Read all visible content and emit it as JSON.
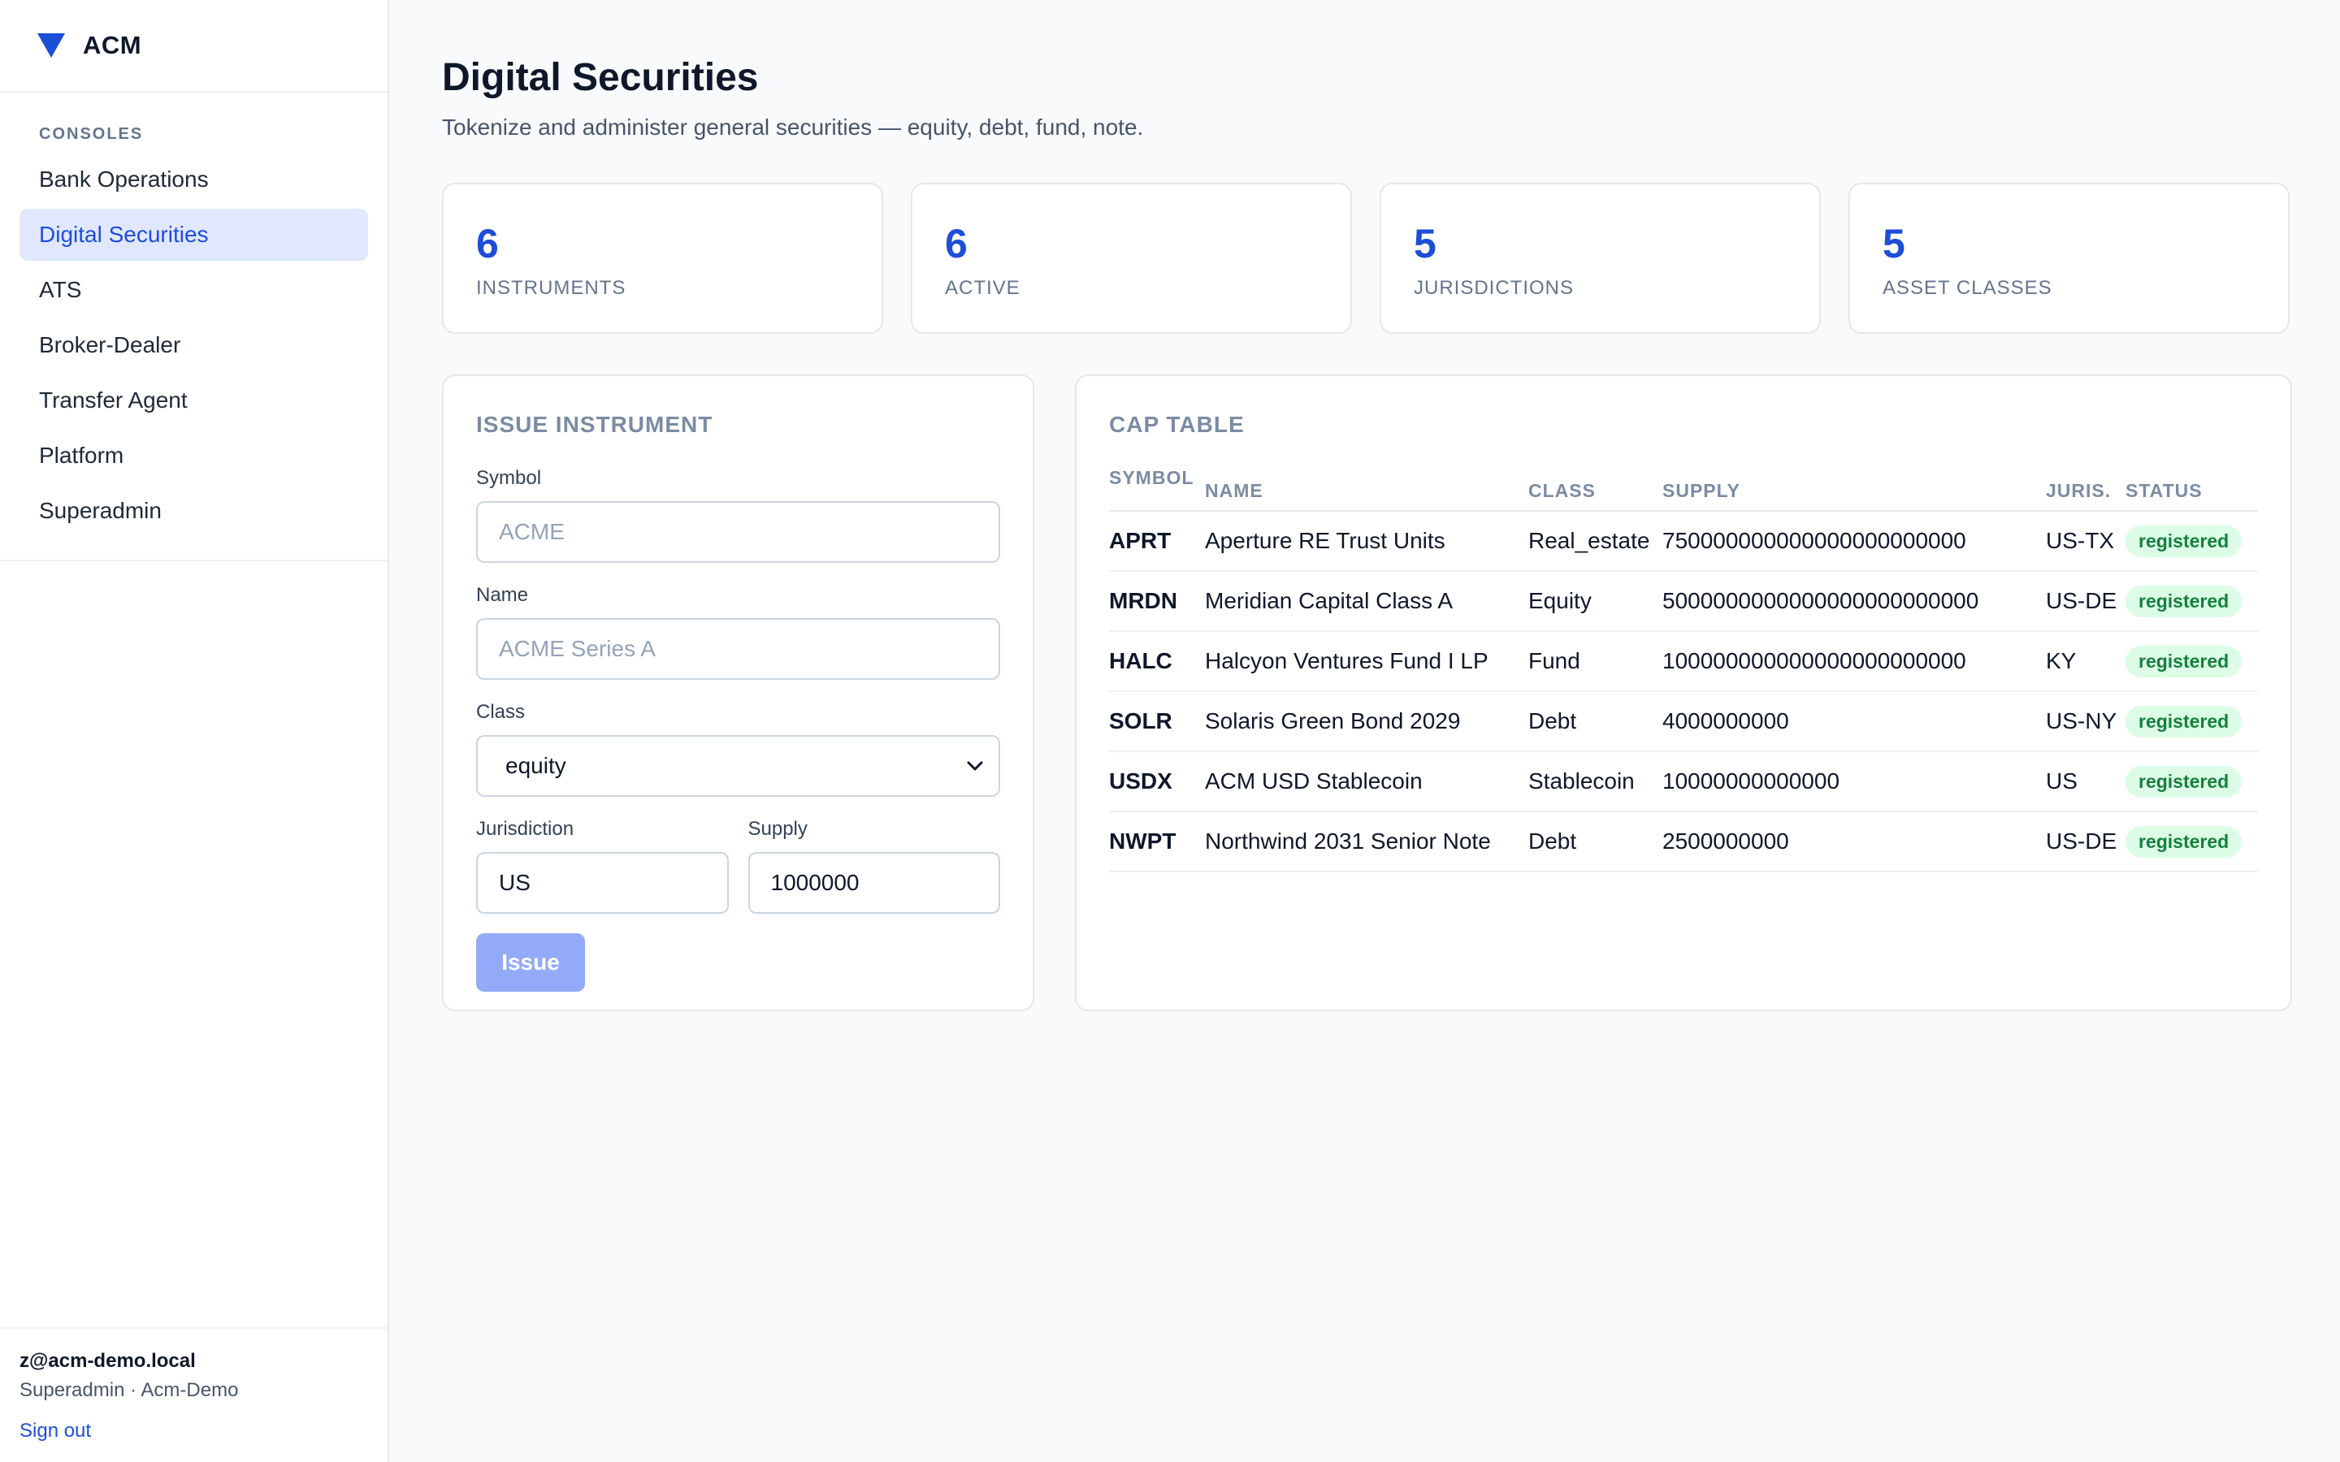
{
  "brand": {
    "name": "ACM",
    "accent": "#1d4ed8"
  },
  "sidebar": {
    "section_label": "CONSOLES",
    "items": [
      {
        "label": "Bank Operations",
        "active": false
      },
      {
        "label": "Digital Securities",
        "active": true
      },
      {
        "label": "ATS",
        "active": false
      },
      {
        "label": "Broker-Dealer",
        "active": false
      },
      {
        "label": "Transfer Agent",
        "active": false
      },
      {
        "label": "Platform",
        "active": false
      },
      {
        "label": "Superadmin",
        "active": false
      }
    ]
  },
  "user": {
    "email": "z@acm-demo.local",
    "role": "Superadmin · Acm-Demo",
    "signout": "Sign out"
  },
  "page": {
    "title": "Digital Securities",
    "subtitle": "Tokenize and administer general securities — equity, debt, fund, note."
  },
  "stats": [
    {
      "value": "6",
      "label": "INSTRUMENTS"
    },
    {
      "value": "6",
      "label": "ACTIVE"
    },
    {
      "value": "5",
      "label": "JURISDICTIONS"
    },
    {
      "value": "5",
      "label": "ASSET CLASSES"
    }
  ],
  "issue_form": {
    "title": "ISSUE INSTRUMENT",
    "symbol": {
      "label": "Symbol",
      "placeholder": "ACME",
      "value": ""
    },
    "name": {
      "label": "Name",
      "placeholder": "ACME Series A",
      "value": ""
    },
    "class": {
      "label": "Class",
      "value": "equity"
    },
    "jurisdiction": {
      "label": "Jurisdiction",
      "value": "US"
    },
    "supply": {
      "label": "Supply",
      "value": "1000000"
    },
    "submit_label": "Issue"
  },
  "cap_table": {
    "title": "CAP TABLE",
    "columns": [
      "SYMBOL",
      "NAME",
      "CLASS",
      "SUPPLY",
      "JURIS.",
      "STATUS"
    ],
    "rows": [
      {
        "symbol": "APRT",
        "name": "Aperture RE Trust Units",
        "class": "Real_estate",
        "supply": "750000000000000000000000",
        "juris": "US-TX",
        "status": "registered"
      },
      {
        "symbol": "MRDN",
        "name": "Meridian Capital Class A",
        "class": "Equity",
        "supply": "5000000000000000000000000",
        "juris": "US-DE",
        "status": "registered"
      },
      {
        "symbol": "HALC",
        "name": "Halcyon Ventures Fund I LP",
        "class": "Fund",
        "supply": "100000000000000000000000",
        "juris": "KY",
        "status": "registered"
      },
      {
        "symbol": "SOLR",
        "name": "Solaris Green Bond 2029",
        "class": "Debt",
        "supply": "4000000000",
        "juris": "US-NY",
        "status": "registered"
      },
      {
        "symbol": "USDX",
        "name": "ACM USD Stablecoin",
        "class": "Stablecoin",
        "supply": "10000000000000",
        "juris": "US",
        "status": "registered"
      },
      {
        "symbol": "NWPT",
        "name": "Northwind 2031 Senior Note",
        "class": "Debt",
        "supply": "2500000000",
        "juris": "US-DE",
        "status": "registered"
      }
    ]
  }
}
